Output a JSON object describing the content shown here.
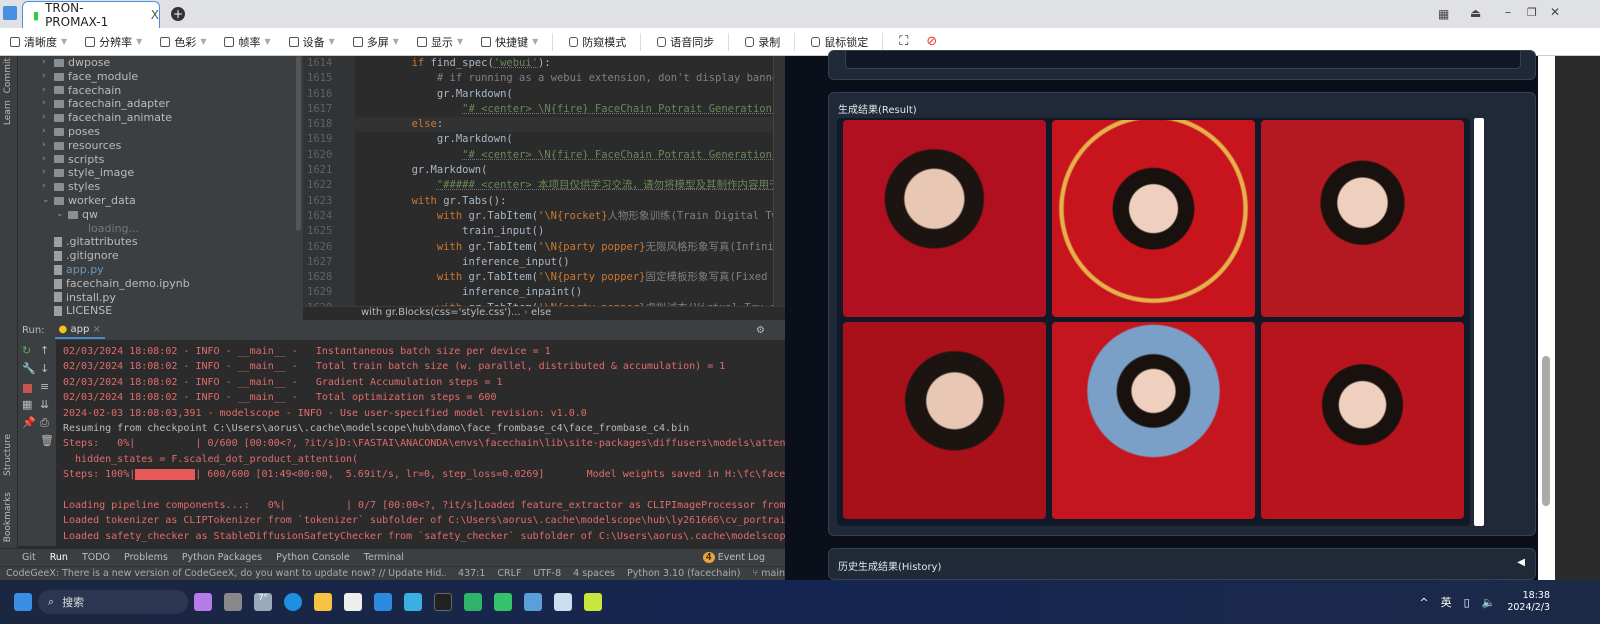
{
  "remote_tab": {
    "title": "TRON-PROMAX-1",
    "close": "X"
  },
  "toolbar": [
    "清晰度",
    "分辨率",
    "色彩",
    "帧率",
    "设备",
    "多屏",
    "显示",
    "快捷键"
  ],
  "toolbar_actions": [
    "防窥模式",
    "语音同步",
    "录制",
    "鼠标锁定"
  ],
  "left_strip": [
    "Commit",
    "Learn",
    "Structure",
    "Bookmarks"
  ],
  "tree": [
    {
      "name": "dwpose",
      "type": "folder",
      "indent": 1
    },
    {
      "name": "face_module",
      "type": "folder",
      "indent": 1
    },
    {
      "name": "facechain",
      "type": "folder",
      "indent": 1
    },
    {
      "name": "facechain_adapter",
      "type": "folder",
      "indent": 1
    },
    {
      "name": "facechain_animate",
      "type": "folder",
      "indent": 1
    },
    {
      "name": "poses",
      "type": "folder",
      "indent": 1
    },
    {
      "name": "resources",
      "type": "folder",
      "indent": 1
    },
    {
      "name": "scripts",
      "type": "folder",
      "indent": 1
    },
    {
      "name": "style_image",
      "type": "folder",
      "indent": 1
    },
    {
      "name": "styles",
      "type": "folder",
      "indent": 1
    },
    {
      "name": "worker_data",
      "type": "folder-open",
      "indent": 1
    },
    {
      "name": "qw",
      "type": "folder-open",
      "indent": 2
    },
    {
      "name": "loading...",
      "type": "loading",
      "indent": 3
    },
    {
      "name": ".gitattributes",
      "type": "file",
      "indent": 1
    },
    {
      "name": ".gitignore",
      "type": "file",
      "indent": 1
    },
    {
      "name": "app.py",
      "type": "file-active",
      "indent": 1
    },
    {
      "name": "facechain_demo.ipynb",
      "type": "file",
      "indent": 1
    },
    {
      "name": "install.py",
      "type": "file",
      "indent": 1
    },
    {
      "name": "LICENSE",
      "type": "file",
      "indent": 1
    },
    {
      "name": "README.md",
      "type": "file",
      "indent": 1
    }
  ],
  "code": [
    {
      "n": "1614",
      "p": [
        [
          "tx",
          "        "
        ],
        [
          "kw",
          "if "
        ],
        [
          "tx",
          "find_spec("
        ],
        [
          "st",
          "'webui'"
        ],
        [
          "tx",
          "):"
        ]
      ]
    },
    {
      "n": "1615",
      "p": [
        [
          "cm",
          "            # if running as a webui extension, don't display banner self-advertisement"
        ]
      ]
    },
    {
      "n": "1616",
      "p": [
        [
          "tx",
          "            gr.Markdown("
        ]
      ]
    },
    {
      "n": "1617",
      "p": [
        [
          "tx",
          "                "
        ],
        [
          "st",
          "\"# <center> \\N{fire} FaceChain Potrait Generation (\\N{whale} "
        ]
      ]
    },
    {
      "n": "1618",
      "p": [
        [
          "tx",
          "        "
        ],
        [
          "kw",
          "else"
        ],
        [
          "tx",
          ":"
        ]
      ],
      "cur": true
    },
    {
      "n": "1619",
      "p": [
        [
          "tx",
          "            gr.Markdown("
        ]
      ]
    },
    {
      "n": "1620",
      "p": [
        [
          "tx",
          "                "
        ],
        [
          "st",
          "\"# <center> \\N{fire} FaceChain Potrait Generation ([Github star"
        ]
      ]
    },
    {
      "n": "1621",
      "p": [
        [
          "tx",
          "        gr.Markdown("
        ]
      ]
    },
    {
      "n": "1622",
      "p": [
        [
          "tx",
          "            "
        ],
        [
          "st",
          "\"##### <center> 本项目仅供学习交流，请勿将模型及其制作内容用于非法活动或违反他"
        ]
      ]
    },
    {
      "n": "1623",
      "p": [
        [
          "tx",
          "        "
        ],
        [
          "kw",
          "with "
        ],
        [
          "tx",
          "gr.Tabs():"
        ]
      ]
    },
    {
      "n": "1624",
      "p": [
        [
          "tx",
          "            "
        ],
        [
          "kw",
          "with "
        ],
        [
          "tx",
          "gr.TabItem("
        ],
        [
          "kw",
          "'\\N{rocket}"
        ],
        [
          "cm",
          "人物形象训练"
        ],
        [
          "cm",
          "(Train Digital Twin)"
        ],
        [
          "kw",
          "'"
        ],
        [
          "tx",
          "):"
        ]
      ]
    },
    {
      "n": "1625",
      "p": [
        [
          "tx",
          "                train_input()"
        ]
      ]
    },
    {
      "n": "1626",
      "p": [
        [
          "tx",
          "            "
        ],
        [
          "kw",
          "with "
        ],
        [
          "tx",
          "gr.TabItem("
        ],
        [
          "kw",
          "'\\N{party popper}"
        ],
        [
          "cm",
          "无限风格形象写真(Infinite Style Portr"
        ]
      ]
    },
    {
      "n": "1627",
      "p": [
        [
          "tx",
          "                inference_input()"
        ]
      ]
    },
    {
      "n": "1628",
      "p": [
        [
          "tx",
          "            "
        ],
        [
          "kw",
          "with "
        ],
        [
          "tx",
          "gr.TabItem("
        ],
        [
          "kw",
          "'\\N{party popper}"
        ],
        [
          "cm",
          "固定模板形象写真(Fixed Templates Po"
        ]
      ]
    },
    {
      "n": "1629",
      "p": [
        [
          "tx",
          "                inference_inpaint()"
        ]
      ]
    },
    {
      "n": "1630",
      "p": [
        [
          "tx",
          "            "
        ],
        [
          "kw",
          "with "
        ],
        [
          "tx",
          "gr.TabItem("
        ],
        [
          "kw",
          "'\\N{party popper}"
        ],
        [
          "cm",
          "虚拟试衣(Virtual Try-on)"
        ],
        [
          "kw",
          "'"
        ],
        [
          "tx",
          "):"
        ]
      ]
    }
  ],
  "breadcrumb": [
    "with gr.Blocks(css='style.css')...",
    "else"
  ],
  "run": {
    "label": "Run:",
    "tab": "app"
  },
  "console": [
    {
      "t": "02/03/2024 18:08:02 - INFO - __main__ -   Instantaneous batch size per device = 1"
    },
    {
      "t": "02/03/2024 18:08:02 - INFO - __main__ -   Total train batch size (w. parallel, distributed & accumulation) = 1"
    },
    {
      "t": "02/03/2024 18:08:02 - INFO - __main__ -   Gradient Accumulation steps = 1"
    },
    {
      "t": "02/03/2024 18:08:02 - INFO - __main__ -   Total optimization steps = 600"
    },
    {
      "t": "2024-02-03 18:08:03,391 - modelscope - INFO - Use user-specified model revision: v1.0.0"
    },
    {
      "t": "Resuming from checkpoint C:\\Users\\aorus\\.cache\\modelscope\\hub\\damo\\face_frombase_c4\\face_frombase_c4.bin",
      "w": true
    },
    {
      "t": "Steps:   0%|          | 0/600 [00:00<?, ?it/s]D:\\FASTAI\\ANACONDA\\envs\\facechain\\lib\\site-packages\\diffusers\\models\\attention_processor.py"
    },
    {
      "t": "  hidden_states = F.scaled_dot_product_attention("
    },
    {
      "t": "Steps: 100%|",
      "bar": true,
      "t2": "| 600/600 [01:49<00:00,  5.69it/s, lr=0, step_loss=0.0269]       Model weights saved in H:\\fc\\facechain\\worker_data"
    },
    {
      "t": " "
    },
    {
      "t": "Loading pipeline components...:   0%|          | 0/7 [00:00<?, ?it/s]Loaded feature_extractor as CLIPImageProcessor from `feature_extractor`"
    },
    {
      "t": "Loaded tokenizer as CLIPTokenizer from `tokenizer` subfolder of C:\\Users\\aorus\\.cache\\modelscope\\hub\\ly261666\\cv_portrait_model\\film"
    },
    {
      "t": "Loaded safety_checker as StableDiffusionSafetyChecker from `safety_checker` subfolder of C:\\Users\\aorus\\.cache\\modelscope\\hub\\ly261666"
    }
  ],
  "progress_percent": 100,
  "bottom_tabs": [
    "Git",
    "Run",
    "TODO",
    "Problems",
    "Python Packages",
    "Python Console",
    "Terminal"
  ],
  "event_log": {
    "count": "4",
    "label": "Event Log"
  },
  "status": {
    "message": "CodeGeeX: There is a new version of CodeGeeX, do you want to update now? // Update   Hid... (36 minutes ago)",
    "position": "437:1",
    "eol": "CRLF",
    "encoding": "UTF-8",
    "indent": "4 spaces",
    "interpreter": "Python 3.10 (facechain)",
    "branch": "main"
  },
  "result": {
    "title": "生成结果(Result)",
    "images": 6
  },
  "history": {
    "title": "历史生成结果(History)",
    "toggle": "◀"
  },
  "taskbar": {
    "search": "搜索",
    "weather": "7°",
    "lang": "英",
    "time": "18:38",
    "date": "2024/2/3"
  }
}
